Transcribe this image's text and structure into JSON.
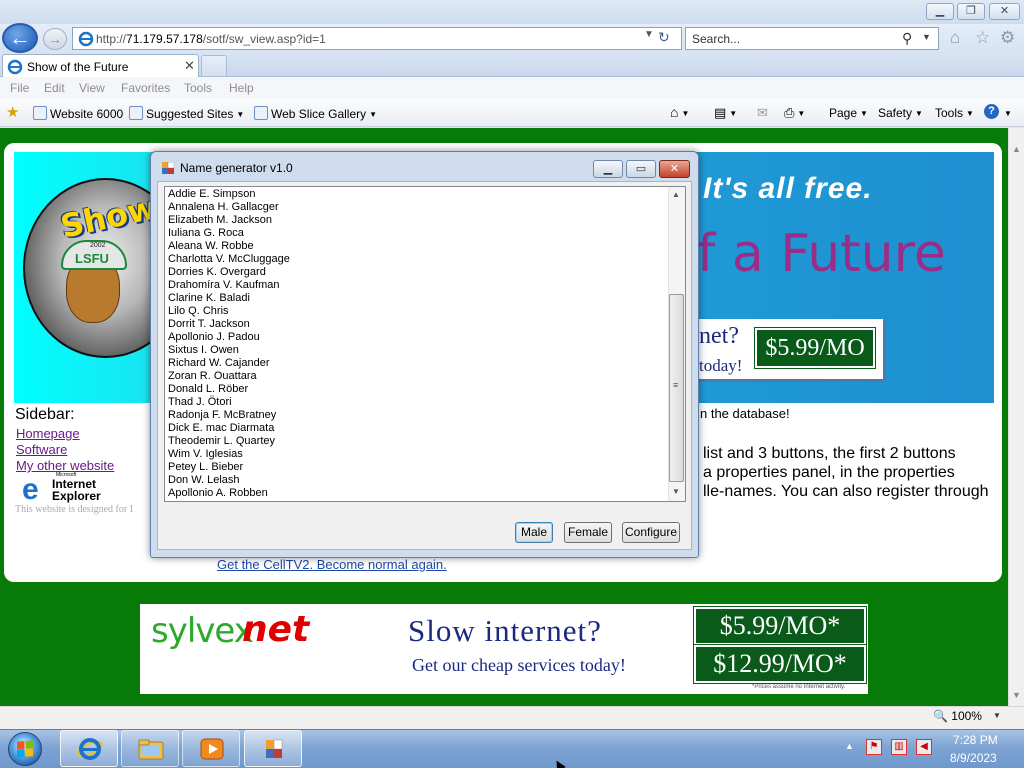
{
  "browser": {
    "address_url_prefix": "http://",
    "address_host": "71.179.57.178",
    "address_path": "/sotf/sw_view.asp?id=1",
    "search_placeholder": "Search...",
    "tab_title": "Show of the Future",
    "menu": [
      "File",
      "Edit",
      "View",
      "Favorites",
      "Tools",
      "Help"
    ],
    "favorites": [
      "Website 6000",
      "Suggested Sites",
      "Web Slice Gallery"
    ],
    "commands": [
      "Page",
      "Safety",
      "Tools"
    ],
    "zoom": "100%"
  },
  "page": {
    "logo_text": "Show",
    "logo_cap_text": "LSFU",
    "logo_cap_year": "2002",
    "tagline_free": "It's all free.",
    "tagline_future": "f a Future",
    "ad_small_slow": "net?",
    "ad_small_today": "today!",
    "ad_small_price": "$5.99/MO",
    "sidebar_title": "Sidebar:",
    "sidebar_links": [
      "Homepage",
      "Software",
      "My other website"
    ],
    "ie_logo_small": "Microsoft",
    "ie_logo_line1": "Internet",
    "ie_logo_line2": "Explorer",
    "designed_for": "This website is designed for I",
    "database_text": "n the database!",
    "body_lines": [
      "list and 3 buttons, the first 2 buttons",
      "a properties panel, in the properties",
      "lle-names. You can also register through"
    ],
    "celltv_link": "Get the CellTV2. Become normal again.",
    "ad": {
      "brand_1": "sylvex",
      "brand_2": "net",
      "slogan": "Slow internet?",
      "subslogan": "Get our cheap services today!",
      "price_1": "$5.99/MO*",
      "price_2": "$12.99/MO*",
      "fine_print": "*Prices assume no Internet activity."
    }
  },
  "dialog": {
    "title": "Name generator v1.0",
    "names": [
      "Addie E. Simpson",
      "Annalena H. Gallacger",
      "Elizabeth M. Jackson",
      "Iuliana G. Roca",
      "Aleana W. Robbe",
      "Charlotta V. McCluggage",
      "Dorries K. Overgard",
      "Drahomíra V. Kaufman",
      "Clarine K. Baladi",
      "Lilo Q. Chris",
      "Dorrit T. Jackson",
      "Apollonio J. Padou",
      "Sixtus I. Owen",
      "Richard W. Cajander",
      "Zoran R. Ouattara",
      "Donald L. Röber",
      "Thad J. Ötori",
      "Radonja F. McBratney",
      "Dick E. mac Diarmata",
      "Theodemir L. Quartey",
      "Wim V. Iglesias",
      "Petey L. Bieber",
      "Don W. Lelash",
      "Apollonio A. Robben"
    ],
    "buttons": {
      "male": "Male",
      "female": "Female",
      "configure": "Configure"
    }
  },
  "taskbar": {
    "clock_time": "7:28 PM",
    "clock_date": "8/9/2023"
  },
  "colors": {
    "page_background": "#077a07",
    "link_visited": "#6a1a8a",
    "link": "#1e4aa8"
  }
}
